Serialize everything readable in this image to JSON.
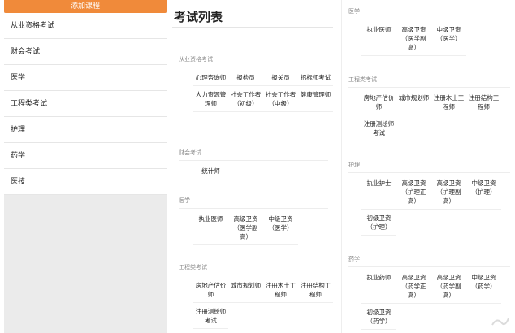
{
  "sidebar": {
    "add_button": "添加课程",
    "categories": [
      "从业资格考试",
      "财会考试",
      "医学",
      "工程类考试",
      "护理",
      "药学",
      "医技"
    ]
  },
  "main": {
    "title": "考试列表",
    "col1": [
      {
        "name": "从业资格考试",
        "items": [
          "心理咨询师",
          "报检员",
          "报关员",
          "招标师考试",
          "人力资源管理师",
          "社会工作者（初级）",
          "社会工作者（中级）",
          "健康管理师"
        ]
      },
      {
        "name": "财会考试",
        "items": [
          "统计师"
        ]
      },
      {
        "name": "医学",
        "items": [
          "执业医师",
          "高级卫资（医学副高）",
          "中级卫资（医学）"
        ]
      },
      {
        "name": "工程类考试",
        "items": [
          "房地产估价师",
          "城市规划师",
          "注册木土工程师",
          "注册结构工程师",
          "注册测绘师考试"
        ]
      }
    ],
    "col2": [
      {
        "name": "医学",
        "items": [
          "执业医师",
          "高级卫资（医学副高）",
          "中级卫资（医学）"
        ]
      },
      {
        "name": "工程类考试",
        "items": [
          "房地产估价师",
          "城市规划师",
          "注册木土工程师",
          "注册结构工程师",
          "注册测绘师考试"
        ]
      },
      {
        "name": "护理",
        "items": [
          "执业护士",
          "高级卫资（护理正高）",
          "高级卫资（护理副高）",
          "中级卫资（护理）",
          "初级卫资（护理）"
        ]
      },
      {
        "name": "药学",
        "items": [
          "执业药师",
          "高级卫资（药学正高）",
          "高级卫资（药学副高）",
          "中级卫资（药学）",
          "初级卫资（药学）"
        ]
      }
    ]
  }
}
